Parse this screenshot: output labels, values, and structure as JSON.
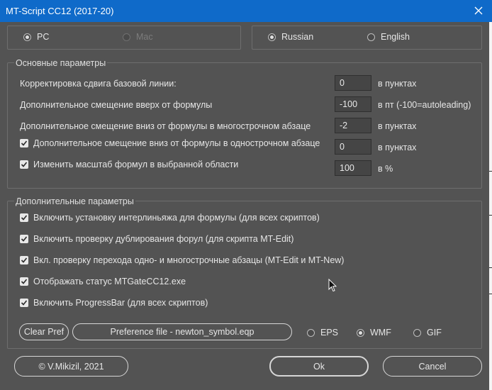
{
  "window": {
    "title": "MT-Script CC12 (2017-20)",
    "close_glyph": "✕"
  },
  "platform": {
    "options": [
      {
        "label": "PC",
        "checked": true,
        "disabled": false
      },
      {
        "label": "Mac",
        "checked": false,
        "disabled": true
      }
    ]
  },
  "language": {
    "options": [
      {
        "label": "Russian",
        "checked": true
      },
      {
        "label": "English",
        "checked": false
      }
    ]
  },
  "basic": {
    "title": "Основные параметры",
    "rows": [
      {
        "label": "Корректировка сдвига базовой линии:",
        "value": "0",
        "unit": "в пунктах",
        "checkbox": false
      },
      {
        "label": "Дополнительное смещение вверх от формулы",
        "value": "-100",
        "unit": "в пт (-100=autoleading)",
        "checkbox": false
      },
      {
        "label": "Дополнительное смещение вниз от формулы в многострочном абзаце",
        "value": "-2",
        "unit": "в пунктах",
        "checkbox": false
      },
      {
        "label": "Дополнительное смещение вниз от формулы в однострочном абзаце",
        "value": "0",
        "unit": "в пунктах",
        "checkbox": true,
        "checked": true
      },
      {
        "label": "Изменить масштаб формул в выбранной области",
        "value": "100",
        "unit": "в %",
        "checkbox": true,
        "checked": true
      }
    ]
  },
  "additional": {
    "title": "Дополнительные параметры",
    "checks": [
      {
        "label": "Включить установку интерлиньяжа для формулы (для всех скриптов)",
        "checked": true
      },
      {
        "label": "Включить проверку дублирования форул (для скрипта MT-Edit)",
        "checked": true
      },
      {
        "label": "Вкл. проверку перехода одно- и многострочные абзацы (MT-Edit и MT-New)",
        "checked": true
      },
      {
        "label": "Отображать статус MTGateCC12.exe",
        "checked": true
      },
      {
        "label": "Включить ProgressBar (для всех скриптов)",
        "checked": true
      }
    ],
    "clear_pref_label": "Clear Pref",
    "pref_file_label": "Preference file - newton_symbol.eqp",
    "formats": [
      {
        "label": "EPS",
        "checked": false
      },
      {
        "label": "WMF",
        "checked": true
      },
      {
        "label": "GIF",
        "checked": false
      }
    ]
  },
  "footer": {
    "copyright_label": "© V.Mikizil, 2021",
    "ok_label": "Ok",
    "cancel_label": "Cancel"
  },
  "colors": {
    "titlebar": "#0f6ac9",
    "dialog_bg": "#535353",
    "input_bg": "#454545",
    "text": "#e6e6e6"
  },
  "icons": {
    "close": "close-icon",
    "check": "checkmark-icon",
    "cursor": "mouse-pointer-icon"
  }
}
